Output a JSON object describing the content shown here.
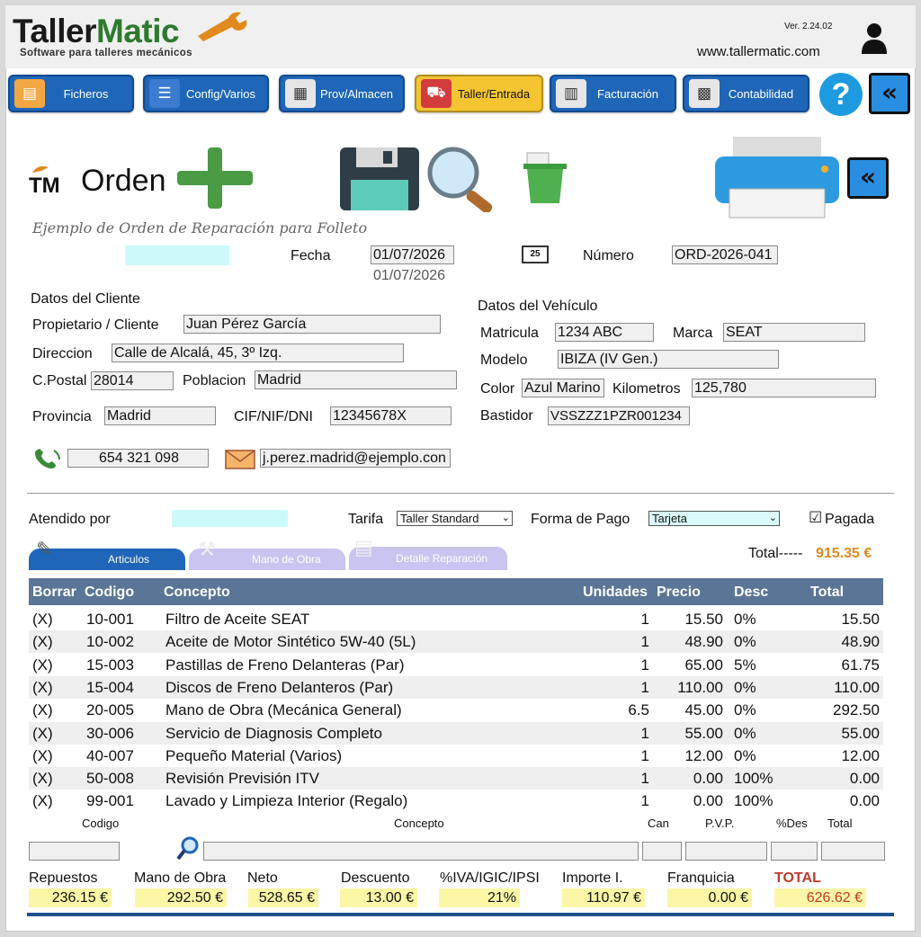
{
  "app": {
    "logo_tm": "Taller",
    "logo_matic": "Matic",
    "tagline": "Software para talleres mecánicos",
    "version": "Ver. 2.24.02",
    "url": "www.tallermatic.com"
  },
  "nav": [
    {
      "label": "Ficheros",
      "icon": "folder-icon"
    },
    {
      "label": "Config/Varios",
      "icon": "settings-icon"
    },
    {
      "label": "Prov/Almacen",
      "icon": "warehouse-icon"
    },
    {
      "label": "Taller/Entrada",
      "icon": "car-lift-icon"
    },
    {
      "label": "Facturación",
      "icon": "invoice-icon"
    },
    {
      "label": "Contabilidad",
      "icon": "calculator-icon"
    }
  ],
  "form": {
    "title": "Orden",
    "subtitle": "Ejemplo de Orden de Reparación para Folleto",
    "fecha_label": "Fecha",
    "fecha": "01/07/2026",
    "fecha_sub": "01/07/2026",
    "numero_label": "Número",
    "numero": "ORD-2026-041"
  },
  "cliente": {
    "section": "Datos del Cliente",
    "propietario_label": "Propietario / Cliente",
    "propietario": "Juan Pérez García",
    "direccion_label": "Direccion",
    "direccion": "Calle de Alcalá, 45, 3º Izq.",
    "cp_label": "C.Postal",
    "cp": "28014",
    "poblacion_label": "Poblacion",
    "poblacion": "Madrid",
    "provincia_label": "Provincia",
    "provincia": "Madrid",
    "nif_label": "CIF/NIF/DNI",
    "nif": "12345678X",
    "telefono": "654 321 098",
    "email": "j.perez.madrid@ejemplo.con"
  },
  "vehiculo": {
    "section": "Datos del Vehículo",
    "matricula_label": "Matricula",
    "matricula": "1234 ABC",
    "marca_label": "Marca",
    "marca": "SEAT",
    "modelo_label": "Modelo",
    "modelo": "IBIZA (IV Gen.)",
    "color_label": "Color",
    "color": "Azul Marino",
    "km_label": "Kilometros",
    "km": "125,780",
    "bastidor_label": "Bastidor",
    "bastidor": "VSSZZZ1PZR001234"
  },
  "order": {
    "atendido_label": "Atendido por",
    "tarifa_label": "Tarifa",
    "tarifa": "Taller Standard",
    "pago_label": "Forma de Pago",
    "pago": "Tarjeta",
    "pagada_label": "Pagada",
    "pagada_check": "☑",
    "total_label": "Total-----",
    "total": "915.35 €"
  },
  "tabs": [
    {
      "label": "Articulos"
    },
    {
      "label": "Mano de Obra"
    },
    {
      "label": "Detalle Reparación"
    }
  ],
  "table": {
    "headers": [
      "Borrar",
      "Codigo",
      "Concepto",
      "Unidades",
      "Precio",
      "Desc",
      "Total"
    ],
    "rows": [
      {
        "del": "(X)",
        "code": "10-001",
        "concept": "Filtro de Aceite SEAT",
        "units": "1",
        "price": "15.50",
        "desc": "0%",
        "total": "15.50"
      },
      {
        "del": "(X)",
        "code": "10-002",
        "concept": "Aceite de Motor Sintético 5W-40 (5L)",
        "units": "1",
        "price": "48.90",
        "desc": "0%",
        "total": "48.90"
      },
      {
        "del": "(X)",
        "code": "15-003",
        "concept": "Pastillas de Freno Delanteras (Par)",
        "units": "1",
        "price": "65.00",
        "desc": "5%",
        "total": "61.75"
      },
      {
        "del": "(X)",
        "code": "15-004",
        "concept": "Discos de Freno Delanteros (Par)",
        "units": "1",
        "price": "110.00",
        "desc": "0%",
        "total": "110.00"
      },
      {
        "del": "(X)",
        "code": "20-005",
        "concept": "Mano de Obra (Mecánica General)",
        "units": "6.5",
        "price": "45.00",
        "desc": "0%",
        "total": "292.50"
      },
      {
        "del": "(X)",
        "code": "30-006",
        "concept": "Servicio de Diagnosis Completo",
        "units": "1",
        "price": "55.00",
        "desc": "0%",
        "total": "55.00"
      },
      {
        "del": "(X)",
        "code": "40-007",
        "concept": "Pequeño Material (Varios)",
        "units": "1",
        "price": "12.00",
        "desc": "0%",
        "total": "12.00"
      },
      {
        "del": "(X)",
        "code": "50-008",
        "concept": "Revisión Previsión ITV",
        "units": "1",
        "price": "0.00",
        "desc": "100%",
        "total": "0.00"
      },
      {
        "del": "(X)",
        "code": "99-001",
        "concept": "Lavado y Limpieza Interior (Regalo)",
        "units": "1",
        "price": "0.00",
        "desc": "100%",
        "total": "0.00"
      }
    ]
  },
  "entry": {
    "codigo": "Codigo",
    "concepto": "Concepto",
    "can": "Can",
    "pvp": "P.V.P.",
    "des": "%Des",
    "total": "Total"
  },
  "summary": {
    "repuestos_label": "Repuestos",
    "repuestos": "236.15 €",
    "mano_label": "Mano de Obra",
    "mano": "292.50 €",
    "neto_label": "Neto",
    "neto": "528.65 €",
    "descuento_label": "Descuento",
    "descuento": "13.00 €",
    "iva_label": "%IVA/IGIC/IPSI",
    "iva": "21%",
    "importe_label": "Importe I.",
    "importe": "110.97 €",
    "franquicia_label": "Franquicia",
    "franquicia": "0.00 €",
    "total_label": "TOTAL",
    "total": "626.62 €"
  },
  "colors": {
    "nav_blue": "#1f66b8",
    "nav_active": "#f5c531",
    "table_header": "#5b7596",
    "highlight": "#fbf7a6",
    "total_red": "#c0392b",
    "accent_orange": "#e08a1e"
  }
}
